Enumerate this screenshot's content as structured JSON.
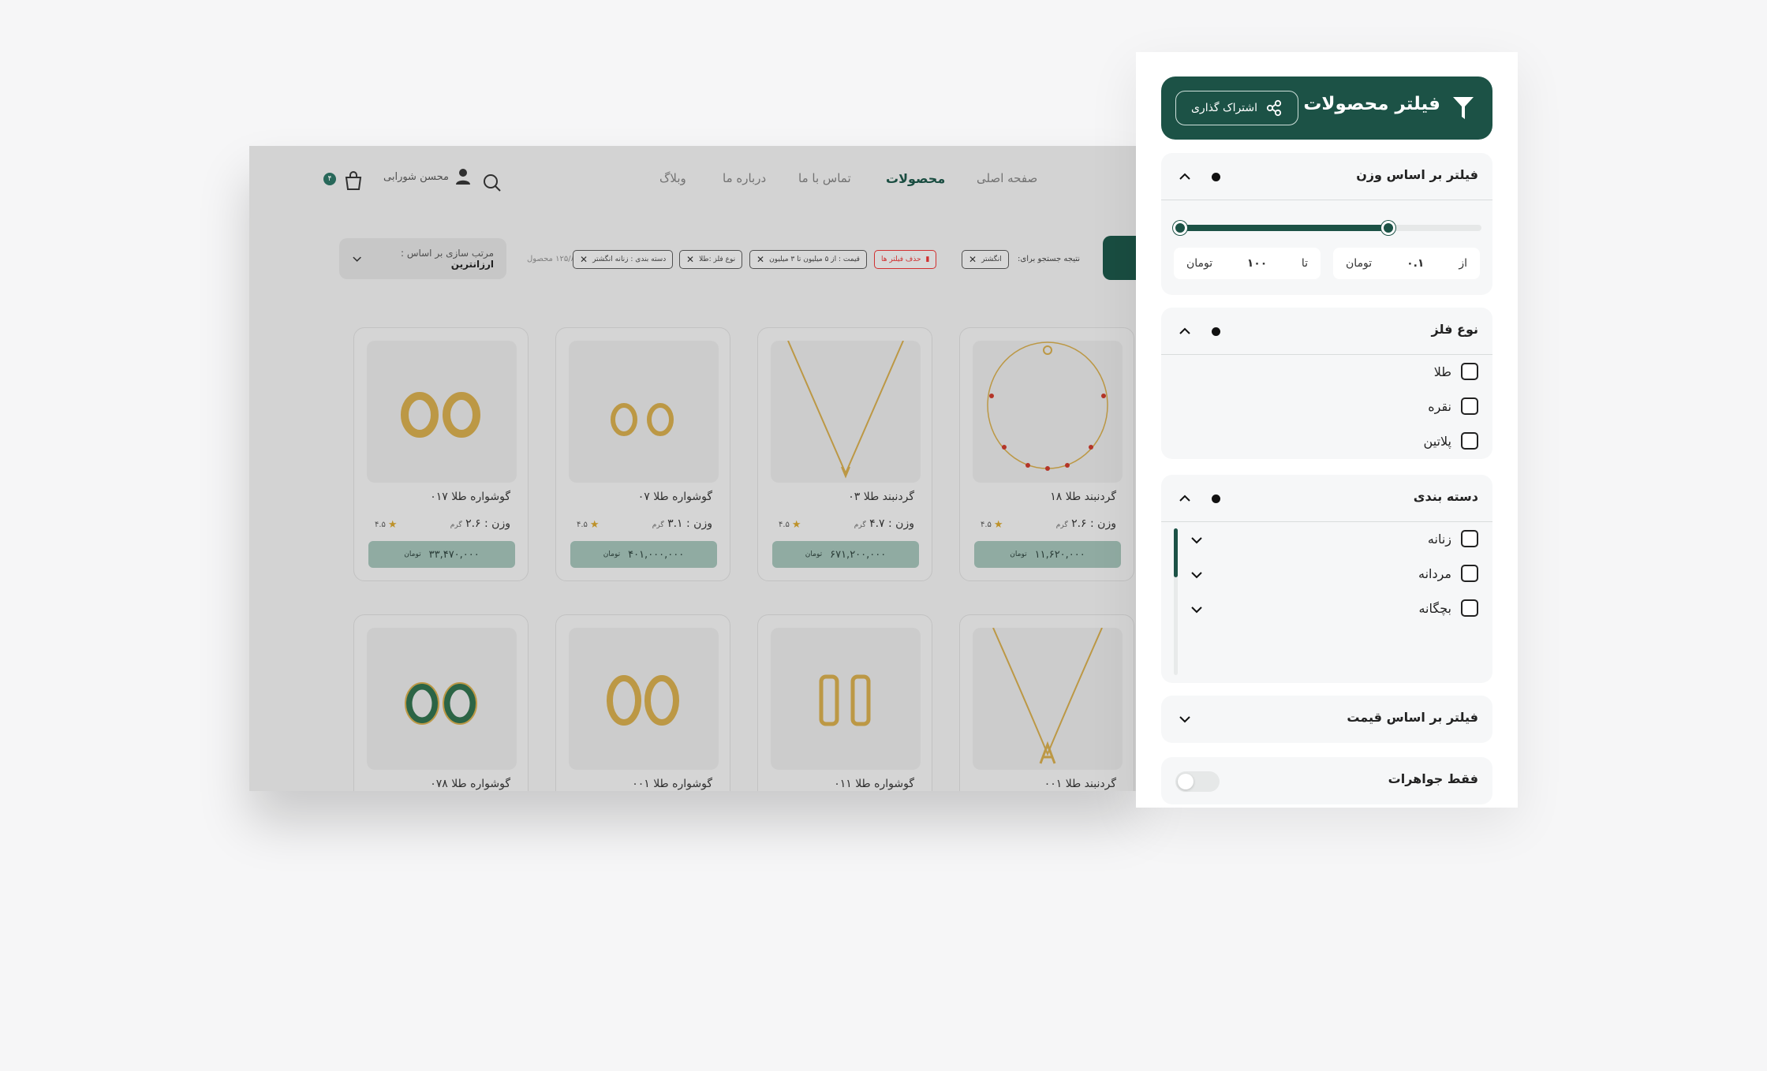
{
  "nav": {
    "home": "صفحه اصلی",
    "products": "محصولات",
    "contact": "تماس با ما",
    "about": "درباره ما",
    "blog": "وبلاگ",
    "user_name": "محسن شورابی",
    "cart_count": "۴"
  },
  "toolbar": {
    "search_result_label": "نتیجه جستجو برای:",
    "chips": [
      "انگشتر",
      "حذف فیلتر ها",
      "قیمت : از ۵ میلیون تا ۳ میلیون",
      "نوع فلز :طلا",
      "دسته بندی : زنانه انگشتر"
    ],
    "count": "۱۲۵/۸ محصول",
    "sort_label": "مرتب سازی بر اساس :",
    "sort_value": "ارزانترین"
  },
  "products": [
    {
      "title": "گردنبند طلا ۱۸",
      "weight": "۲.۶",
      "unit": "گرم",
      "weight_label": "وزن :",
      "rating": "۴.۵",
      "price": "۱۱,۶۲۰,۰۰۰",
      "currency": "تومان"
    },
    {
      "title": "گردنبند طلا ۰۳",
      "weight": "۴.۷",
      "unit": "گرم",
      "weight_label": "وزن :",
      "rating": "۴.۵",
      "price": "۶۷۱,۲۰۰,۰۰۰",
      "currency": "تومان"
    },
    {
      "title": "گوشواره  طلا ۰۷",
      "weight": "۳.۱",
      "unit": "گرم",
      "weight_label": "وزن :",
      "rating": "۴.۵",
      "price": "۴۰۱,۰۰۰,۰۰۰",
      "currency": "تومان"
    },
    {
      "title": "گوشواره  طلا ۰۱۷",
      "weight": "۲.۶",
      "unit": "گرم",
      "weight_label": "وزن :",
      "rating": "۴.۵",
      "price": "۳۳,۴۷۰,۰۰۰",
      "currency": "تومان"
    },
    {
      "title": "گردنبند طلا ۰۰۱"
    },
    {
      "title": "گوشواره  طلا ۰۱۱"
    },
    {
      "title": "گوشواره  طلا ۰۰۱"
    },
    {
      "title": "گوشواره  طلا ۰۷۸"
    }
  ],
  "filter": {
    "title": "فیلتر محصولات",
    "share": "اشتراک گذاری",
    "weight": {
      "title": "فیلتر بر اساس وزن",
      "from_label": "از",
      "from_value": "۰.۱",
      "to_label": "تا",
      "to_value": "۱۰۰",
      "unit": "تومان",
      "range_start": 0,
      "range_end": 0.69
    },
    "metal": {
      "title": "نوع فلز",
      "options": [
        "طلا",
        "نقره",
        "پلاتین"
      ]
    },
    "category": {
      "title": "دسته بندی",
      "options": [
        "زنانه",
        "مردانه",
        "بچگانه"
      ]
    },
    "price": {
      "title": "فیلتر بر اساس قیمت"
    },
    "jewels_only": {
      "title": "فقط جواهرات",
      "on": false
    }
  },
  "colors": {
    "brand": "#1c5246",
    "accent_gold": "#c99b2b",
    "price_bg": "#99b6ad"
  }
}
